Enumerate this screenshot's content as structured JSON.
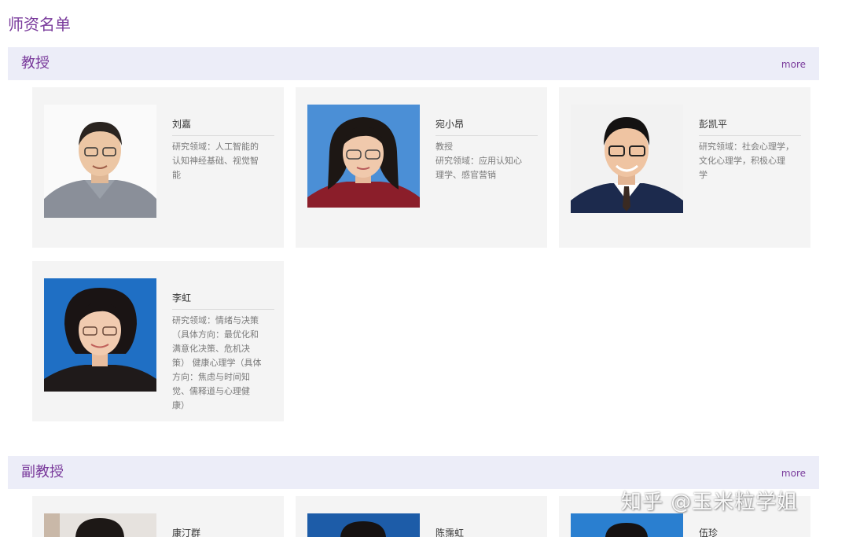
{
  "page": {
    "title": "师资名单"
  },
  "sections": {
    "professor": {
      "name": "教授",
      "more": "more",
      "cards": [
        {
          "name": "刘嘉",
          "lines": [
            "研究领域：人工智能的",
            "认知神经基础、视觉智",
            "能"
          ]
        },
        {
          "name": "宛小昂",
          "lines": [
            "教授",
            "研究领域：应用认知心",
            "理学、感官营销"
          ]
        },
        {
          "name": "彭凯平",
          "lines": [
            "研究领域：社会心理学，",
            "文化心理学，积极心理",
            "学"
          ]
        },
        {
          "name": "李虹",
          "lines": [
            "研究领域：情绪与决策",
            "（具体方向：最优化和",
            "满意化决策、危机决",
            "策） 健康心理学（具体",
            "方向：焦虑与时间知",
            "觉、儒释道与心理健",
            "康）"
          ]
        }
      ]
    },
    "associate": {
      "name": "副教授",
      "more": "more",
      "cards": [
        {
          "name": "康汀群"
        },
        {
          "name": "陈霈虹"
        },
        {
          "name": "伍珍"
        }
      ]
    }
  },
  "watermark": "知乎 @玉米粒学姐",
  "colors": {
    "accent": "#7a3b9c",
    "section_bar": "#ecedf8",
    "card_bg": "#f4f4f4",
    "photo_bg_blue": "#1e6ec2",
    "photo_bg_light": "#f5f5f5"
  }
}
